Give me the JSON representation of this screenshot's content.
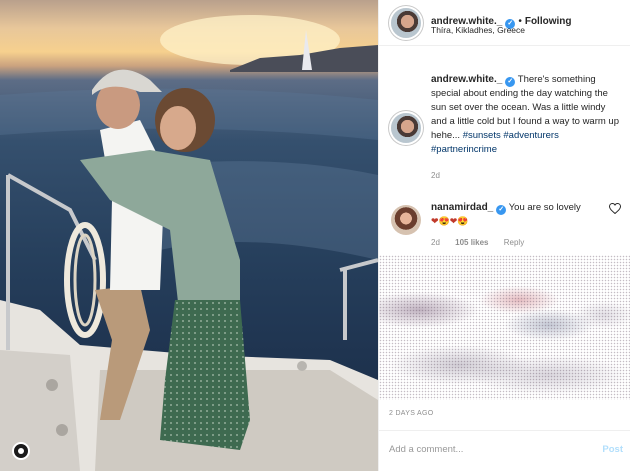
{
  "header": {
    "username": "andrew.white._",
    "separator": "•",
    "follow_label": "Following",
    "location": "Thíra, Kikladhes, Greece"
  },
  "caption": {
    "username": "andrew.white._",
    "text": "There's something special about ending the day watching the sun set over the ocean. Was a little windy and a little cold but I found a way to warm up hehe...",
    "hashtags": [
      "#sunsets",
      "#adventurers",
      "#partnerincrime"
    ],
    "time": "2d"
  },
  "comment": {
    "username": "nanamirdad_",
    "text": "You are so lovely",
    "emojis": "❤😍❤😍",
    "time": "2d",
    "likes": "105 likes",
    "reply_label": "Reply"
  },
  "footer": {
    "date": "2 DAYS AGO",
    "add_placeholder": "Add a comment...",
    "post_label": "Post"
  },
  "colors": {
    "verified": "#3897f0",
    "hashtag": "#003569",
    "muted": "#8e8e8e",
    "post_disabled": "#b2dffc"
  },
  "icons": {
    "verified": "verified-badge-icon",
    "like": "heart-icon",
    "left_control": "circle-icon"
  }
}
